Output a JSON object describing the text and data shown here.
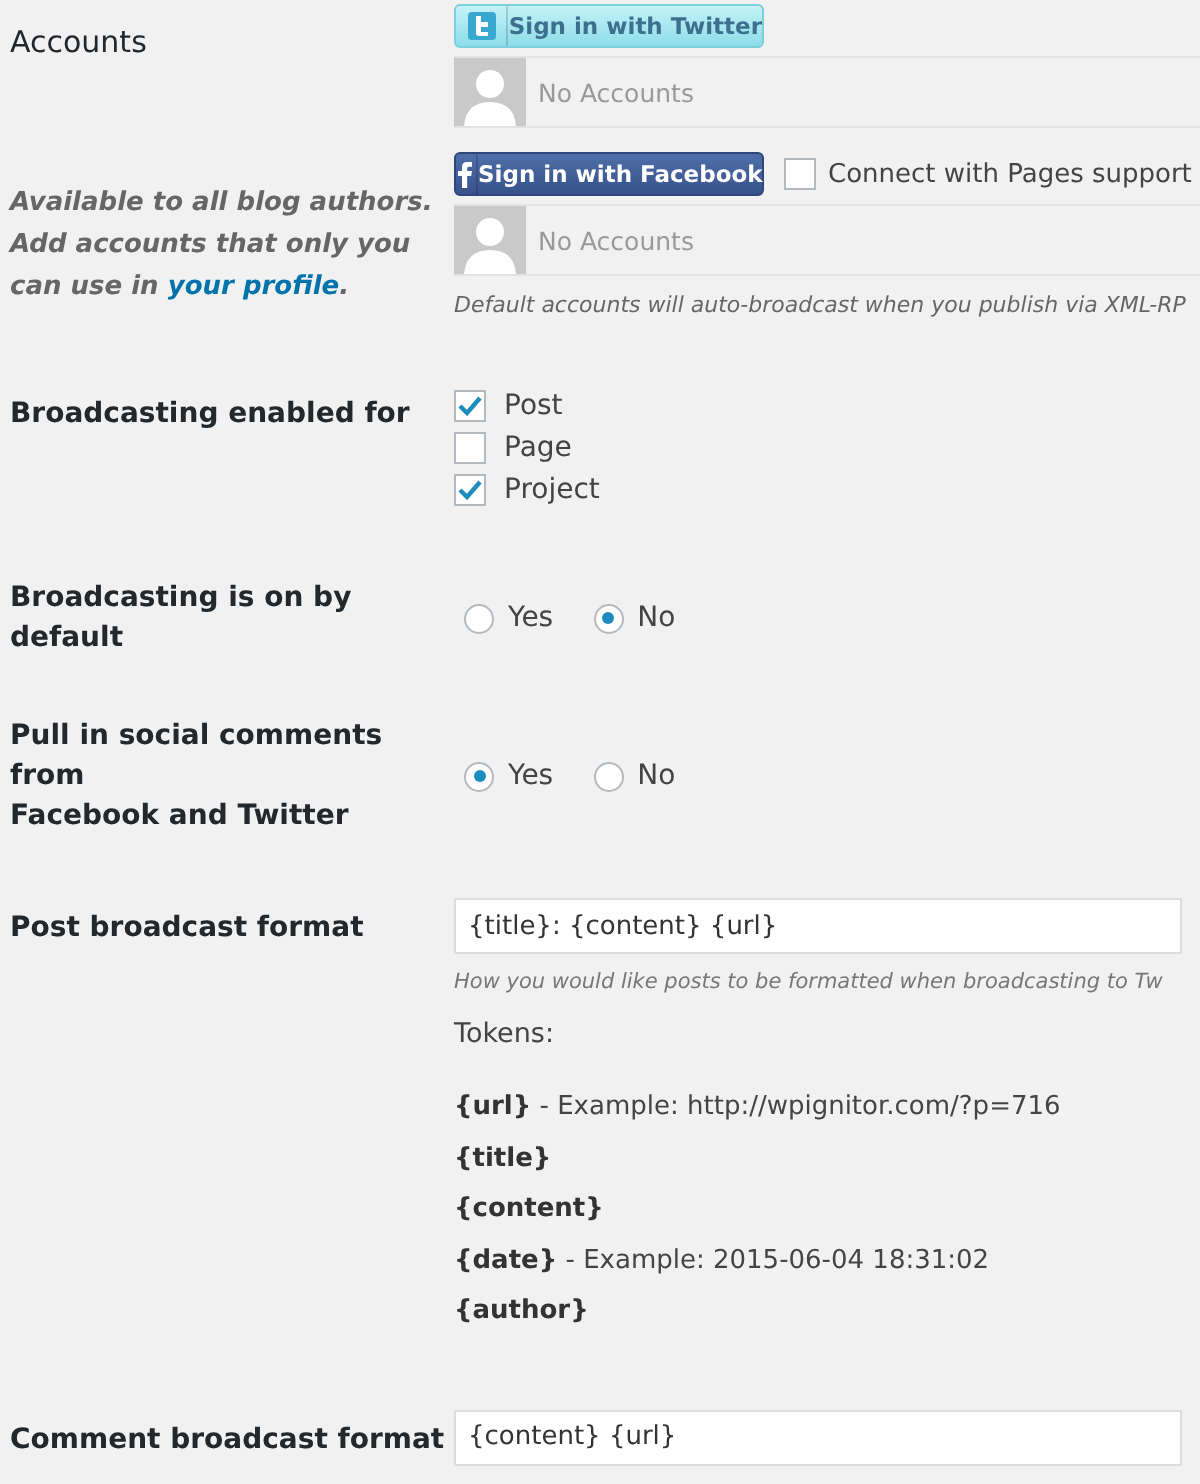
{
  "accounts": {
    "label": "Accounts",
    "note": "Available to all blog authors. Add accounts that only you can use in",
    "note_link": "your profile",
    "note_end": ".",
    "services": [
      {
        "kind": "twitter",
        "button": "Sign in with Twitter",
        "accounts_text": "No Accounts"
      },
      {
        "kind": "facebook",
        "button": "Sign in with Facebook",
        "option": {
          "label": "Connect with Pages support",
          "checked": false
        },
        "accounts_text": "No Accounts"
      }
    ],
    "footnote": "Default accounts will auto-broadcast when you publish via XML-RP"
  },
  "enabled_for": {
    "label": "Broadcasting enabled for",
    "options": [
      {
        "label": "Post",
        "checked": true
      },
      {
        "label": "Page",
        "checked": false
      },
      {
        "label": "Project",
        "checked": true
      }
    ]
  },
  "radios": [
    {
      "label": "Broadcasting is on by default",
      "options": [
        {
          "label": "Yes",
          "selected": false
        },
        {
          "label": "No",
          "selected": true
        }
      ]
    },
    {
      "label": "Pull in social comments from Facebook and Twitter",
      "options": [
        {
          "label": "Yes",
          "selected": true
        },
        {
          "label": "No",
          "selected": false
        }
      ]
    }
  ],
  "post_format": {
    "label": "Post broadcast format",
    "value": "{title}: {content} {url}",
    "hint": "How you would like posts to be formatted when broadcasting to Tw",
    "tokens_label": "Tokens:",
    "tokens": [
      "**{url}** - Example: http://wpignitor.com/?p=716",
      "**{title}**",
      "**{content}**",
      "**{date}** - Example: 2015-06-04 18:31:02",
      "**{author}**"
    ]
  },
  "comment_format": {
    "label": "Comment broadcast format",
    "value": "{content} {url}"
  }
}
